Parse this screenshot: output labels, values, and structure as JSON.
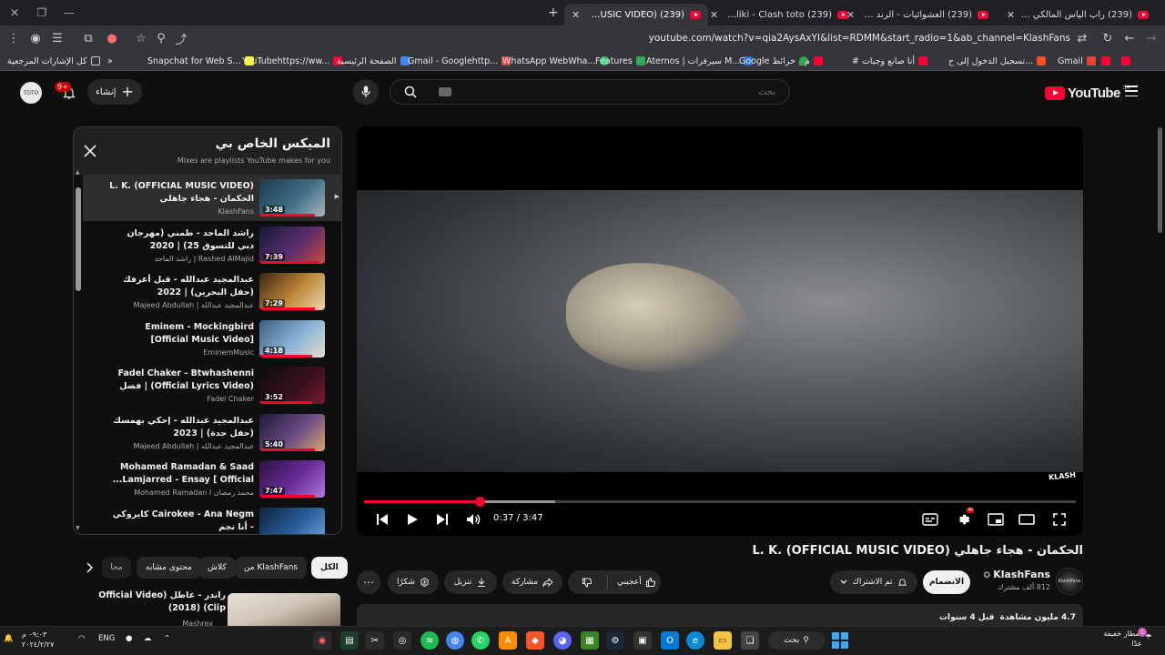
{
  "browser": {
    "tabs": [
      {
        "title": "(239) راب الياس المالكي - YouTube",
        "active": false
      },
      {
        "title": "(239) العشوائيات - الرند والبونق",
        "active": false
      },
      {
        "title": "(239) Ilyas El Maliki - Clash toto",
        "active": false
      },
      {
        "title": "(239) L. K. (OFFICIAL MUSIC VIDEO)",
        "active": true
      }
    ],
    "new_tab": "+",
    "url": "youtube.com/watch?v=qia2AysAxYI&list=RDMM&start_radio=1&ab_channel=KlashFans",
    "bookmarks_all": "كل الإشارات المرجعية",
    "bookmarks_more": "»",
    "bookmarks": [
      {
        "label": "Snapchat for Web S...",
        "color": "#fffc00"
      },
      {
        "label": "YouTubehttps://ww...",
        "color": "#ff0033"
      },
      {
        "label": "الصفحة الرئيسية",
        "color": "#4285f4"
      },
      {
        "label": "Gmail - Googlehttp...",
        "color": "#ea4335"
      },
      {
        "label": "WhatsApp WebWha...",
        "color": "#25d366"
      },
      {
        "label": "Features",
        "color": "#34a853"
      },
      {
        "label": "Aternos | سيرفرات M...",
        "color": "#1a73e8"
      },
      {
        "label": "Google خرائط",
        "color": "#34a853"
      },
      {
        "label": "م",
        "color": "#ff0033"
      },
      {
        "label": "# أنا صانع وجبات",
        "color": "#ff0033"
      },
      {
        "label": "تسجيل الدخول إلى ح...",
        "color": "#f25022"
      },
      {
        "label": "Gmail",
        "color": "#ea4335"
      }
    ]
  },
  "masthead": {
    "avatar_text": "TOTO",
    "notif_count": "9+",
    "create_label": "إنشاء",
    "search_placeholder": "بحث",
    "logo_text": "YouTube",
    "logo_country": "SA"
  },
  "mix": {
    "title": "الميكس الخاص بي",
    "subtitle": "Mixes are playlists YouTube makes for you",
    "items": [
      {
        "title": "L. K. (OFFICIAL MUSIC VIDEO) الحكمان - هجاء جاهلي",
        "channel": "KlashFans",
        "duration": "3:48",
        "progress": 0.85,
        "active": true,
        "thumb": "linear-gradient(135deg,#1e3b4d,#3e6d84 55%,#a8b7bd)"
      },
      {
        "title": "راشد الماجد - طمني (مهرجان دبي للتسوق 25) | 2020",
        "channel": "Rashed AlMajid | راشد الماجد",
        "duration": "7:39",
        "progress": 0.9,
        "active": false,
        "thumb": "linear-gradient(135deg,#151a35,#5b2d6e 55%,#c94d3a)"
      },
      {
        "title": "عبدالمجيد عبدالله - قبل أعرفك (حفل البحرين) | 2022",
        "channel": "عبدالمجيد عبدالله | Majeed Abdullah",
        "duration": "7:29",
        "progress": 0.85,
        "active": false,
        "thumb": "linear-gradient(135deg,#3a2410,#c08a3a 55%,#e9d7b0)"
      },
      {
        "title": "Eminem - Mockingbird [Official Music Video]",
        "channel": "EminemMusic",
        "duration": "4:18",
        "progress": 0.8,
        "active": false,
        "thumb": "linear-gradient(135deg,#3e5e80,#89b3d6 55%,#e6ddd0)"
      },
      {
        "title": "Fadel Chaker - Btwhashenni (Official Lyrics Video) | فضل شاكر",
        "channel": "Fadel Chaker",
        "duration": "3:52",
        "progress": 0.8,
        "active": false,
        "thumb": "linear-gradient(135deg,#0d0d0d,#3a1020 60%,#7d1a2e)"
      },
      {
        "title": "عبدالمجيد عبدالله - إحكي بهمسك (حفل جدة) | 2023",
        "channel": "عبدالمجيد عبدالله | Majeed Abdullah",
        "duration": "5:40",
        "progress": 0.85,
        "active": false,
        "thumb": "linear-gradient(135deg,#1d1a30,#6a4c86 55%,#d9a86a)"
      },
      {
        "title": "Mohamed Ramadan & Saad Lamjarred - Ensay [ Official...",
        "channel": "محمد رمضان Mohamed Ramadan I",
        "duration": "7:47",
        "progress": 0.85,
        "active": false,
        "thumb": "linear-gradient(135deg,#2a1440,#6a2c9a 55%,#b07ad9)"
      },
      {
        "title": "Cairokee - Ana Negm كايروكي - أنا نجم",
        "channel": "",
        "duration": "3:58",
        "progress": 0.8,
        "active": false,
        "thumb": "linear-gradient(135deg,#0f2440,#2a5f9a 55%,#78a8d9)"
      }
    ]
  },
  "chips": [
    {
      "label": "الكل",
      "active": true
    },
    {
      "label": "من KlashFans",
      "active": false
    },
    {
      "label": "كلاش",
      "active": false
    },
    {
      "label": "محتوى مشابه",
      "active": false
    },
    {
      "label": "محا",
      "active": false
    }
  ],
  "next_video": {
    "title": "راندر - عاطل (Official Video Clip) (2018)",
    "channel": "Mashrex"
  },
  "player": {
    "current": "0:37",
    "duration": "3:47",
    "time_text": "0:37 / 3:47",
    "progress": 0.163,
    "watermark": "KLASH",
    "hd_badge": "4K"
  },
  "video": {
    "title": "الحكمان - هجاء جاهلي (L. K. (OFFICIAL MUSIC VIDEO",
    "channel": "KlashFans",
    "channel_avatar_text": "KlashFans",
    "subscribers": "812 ألف مشترك",
    "join_label": "الانضمام",
    "subscribed_label": "تم الاشتراك",
    "like_label": "أعجبني",
    "share_label": "مشاركة",
    "download_label": "تنزيل",
    "thanks_label": "شكرًا",
    "views": "4.7 مليون مشاهدة",
    "age": "قبل 4 سنوات"
  },
  "taskbar": {
    "search_label": "بحث",
    "lang": "ENG",
    "weather_line1": "أمطار خفيفة",
    "weather_line2": "غدًا",
    "weather_badge": "1",
    "clock_time": "٠٩:٠٣ م",
    "clock_date": "٢٠٢٤/٢/٢٧"
  }
}
